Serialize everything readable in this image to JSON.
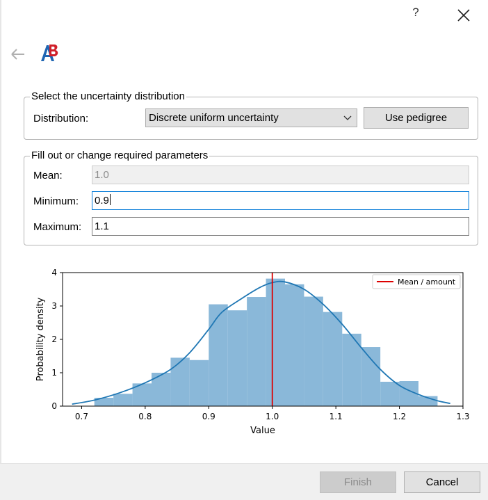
{
  "titlebar": {
    "help_label": "?"
  },
  "group_distribution": {
    "title": "Select the uncertainty distribution",
    "distribution_label": "Distribution:",
    "selected_distribution": "Discrete uniform uncertainty",
    "use_pedigree_label": "Use pedigree"
  },
  "group_parameters": {
    "title": "Fill out or change required parameters",
    "mean_label": "Mean:",
    "mean_value": "1.0",
    "minimum_label": "Minimum:",
    "minimum_value": "0.9",
    "maximum_label": "Maximum:",
    "maximum_value": "1.1"
  },
  "colors": {
    "hist_fill": "#8ab8d9",
    "kde_line": "#1f77b4",
    "mean_line": "#dd0000",
    "focus_border": "#0078d7",
    "logo_blue": "#1f66b3",
    "logo_red": "#d0202a"
  },
  "chart_data": {
    "type": "bar",
    "xlabel": "Value",
    "ylabel": "Probability density",
    "xlim": [
      0.67,
      1.3
    ],
    "ylim": [
      0,
      4
    ],
    "xticks": [
      0.7,
      0.8,
      0.9,
      1.0,
      1.1,
      1.2,
      1.3
    ],
    "xtick_labels": [
      "0.7",
      "0.8",
      "0.9",
      "1.0",
      "1.1",
      "1.2",
      "1.3"
    ],
    "yticks": [
      0,
      1,
      2,
      3,
      4
    ],
    "ytick_labels": [
      "0",
      "1",
      "2",
      "3",
      "4"
    ],
    "legend": {
      "label": "Mean / amount",
      "placement": "top-right"
    },
    "mean_value": 1.0,
    "histogram": {
      "bin_edges": [
        0.72,
        0.75,
        0.78,
        0.81,
        0.84,
        0.87,
        0.9,
        0.93,
        0.96,
        0.99,
        1.02,
        1.05,
        1.08,
        1.11,
        1.14,
        1.17,
        1.2,
        1.23,
        1.26
      ],
      "values": [
        0.25,
        0.37,
        0.68,
        1.0,
        1.45,
        1.38,
        3.05,
        2.87,
        3.27,
        3.82,
        3.65,
        3.28,
        2.82,
        2.17,
        1.77,
        0.73,
        0.75,
        0.3
      ]
    },
    "kde": {
      "x": [
        0.685,
        0.72,
        0.76,
        0.8,
        0.84,
        0.87,
        0.9,
        0.92,
        0.95,
        0.98,
        1.0,
        1.02,
        1.05,
        1.08,
        1.11,
        1.14,
        1.17,
        1.2,
        1.23,
        1.26,
        1.28
      ],
      "y": [
        0.06,
        0.18,
        0.4,
        0.7,
        1.1,
        1.6,
        2.3,
        2.8,
        3.2,
        3.55,
        3.7,
        3.72,
        3.5,
        3.05,
        2.45,
        1.75,
        1.1,
        0.62,
        0.35,
        0.16,
        0.08
      ]
    }
  }
}
